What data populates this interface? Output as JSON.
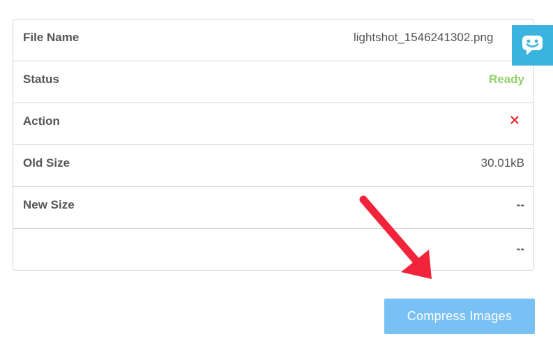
{
  "table": {
    "rows": [
      {
        "label": "File Name",
        "value": "lightshot_1546241302.png"
      },
      {
        "label": "Status",
        "value": "Ready"
      },
      {
        "label": "Action",
        "icon": "close-icon"
      },
      {
        "label": "Old Size",
        "value": "30.01kB"
      },
      {
        "label": "New Size",
        "value": "--"
      },
      {
        "label": "",
        "value": "--"
      }
    ]
  },
  "compress_button": {
    "label": "Compress Images"
  },
  "chat_widget": {
    "icon": "chat-bubble-icon"
  },
  "annotation": {
    "icon": "red-arrow-icon"
  },
  "colors": {
    "status_ready": "#8fd16b",
    "remove": "#e3262d",
    "button": "#79c1f5",
    "chat": "#3ab4de",
    "arrow": "#f2243b"
  }
}
